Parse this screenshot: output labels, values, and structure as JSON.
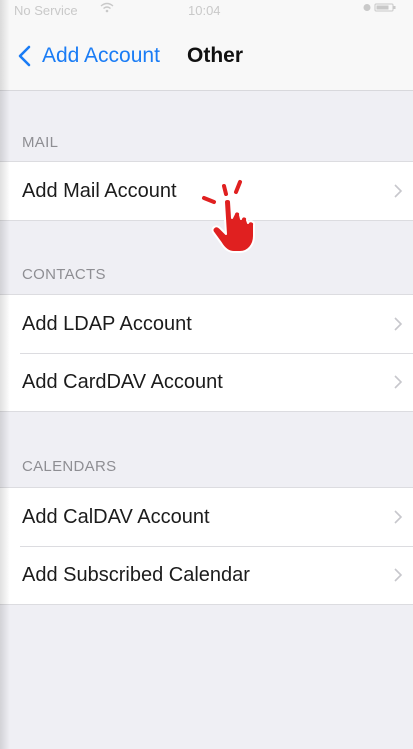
{
  "status_bar": {
    "carrier": "No Service",
    "time": "10:04"
  },
  "nav": {
    "back_label": "Add Account",
    "title": "Other"
  },
  "sections": {
    "mail": {
      "header": "MAIL",
      "items": [
        "Add Mail Account"
      ]
    },
    "contacts": {
      "header": "CONTACTS",
      "items": [
        "Add LDAP Account",
        "Add CardDAV Account"
      ]
    },
    "calendars": {
      "header": "CALENDARS",
      "items": [
        "Add CalDAV Account",
        "Add Subscribed Calendar"
      ]
    }
  },
  "icons": {
    "back": "chevron-left-icon",
    "disclosure": "chevron-right-icon",
    "wifi": "wifi-icon",
    "pointer": "tap-hand-icon"
  },
  "colors": {
    "accent": "#1a7cf5",
    "background": "#efeff4",
    "pointer": "#e02020"
  }
}
